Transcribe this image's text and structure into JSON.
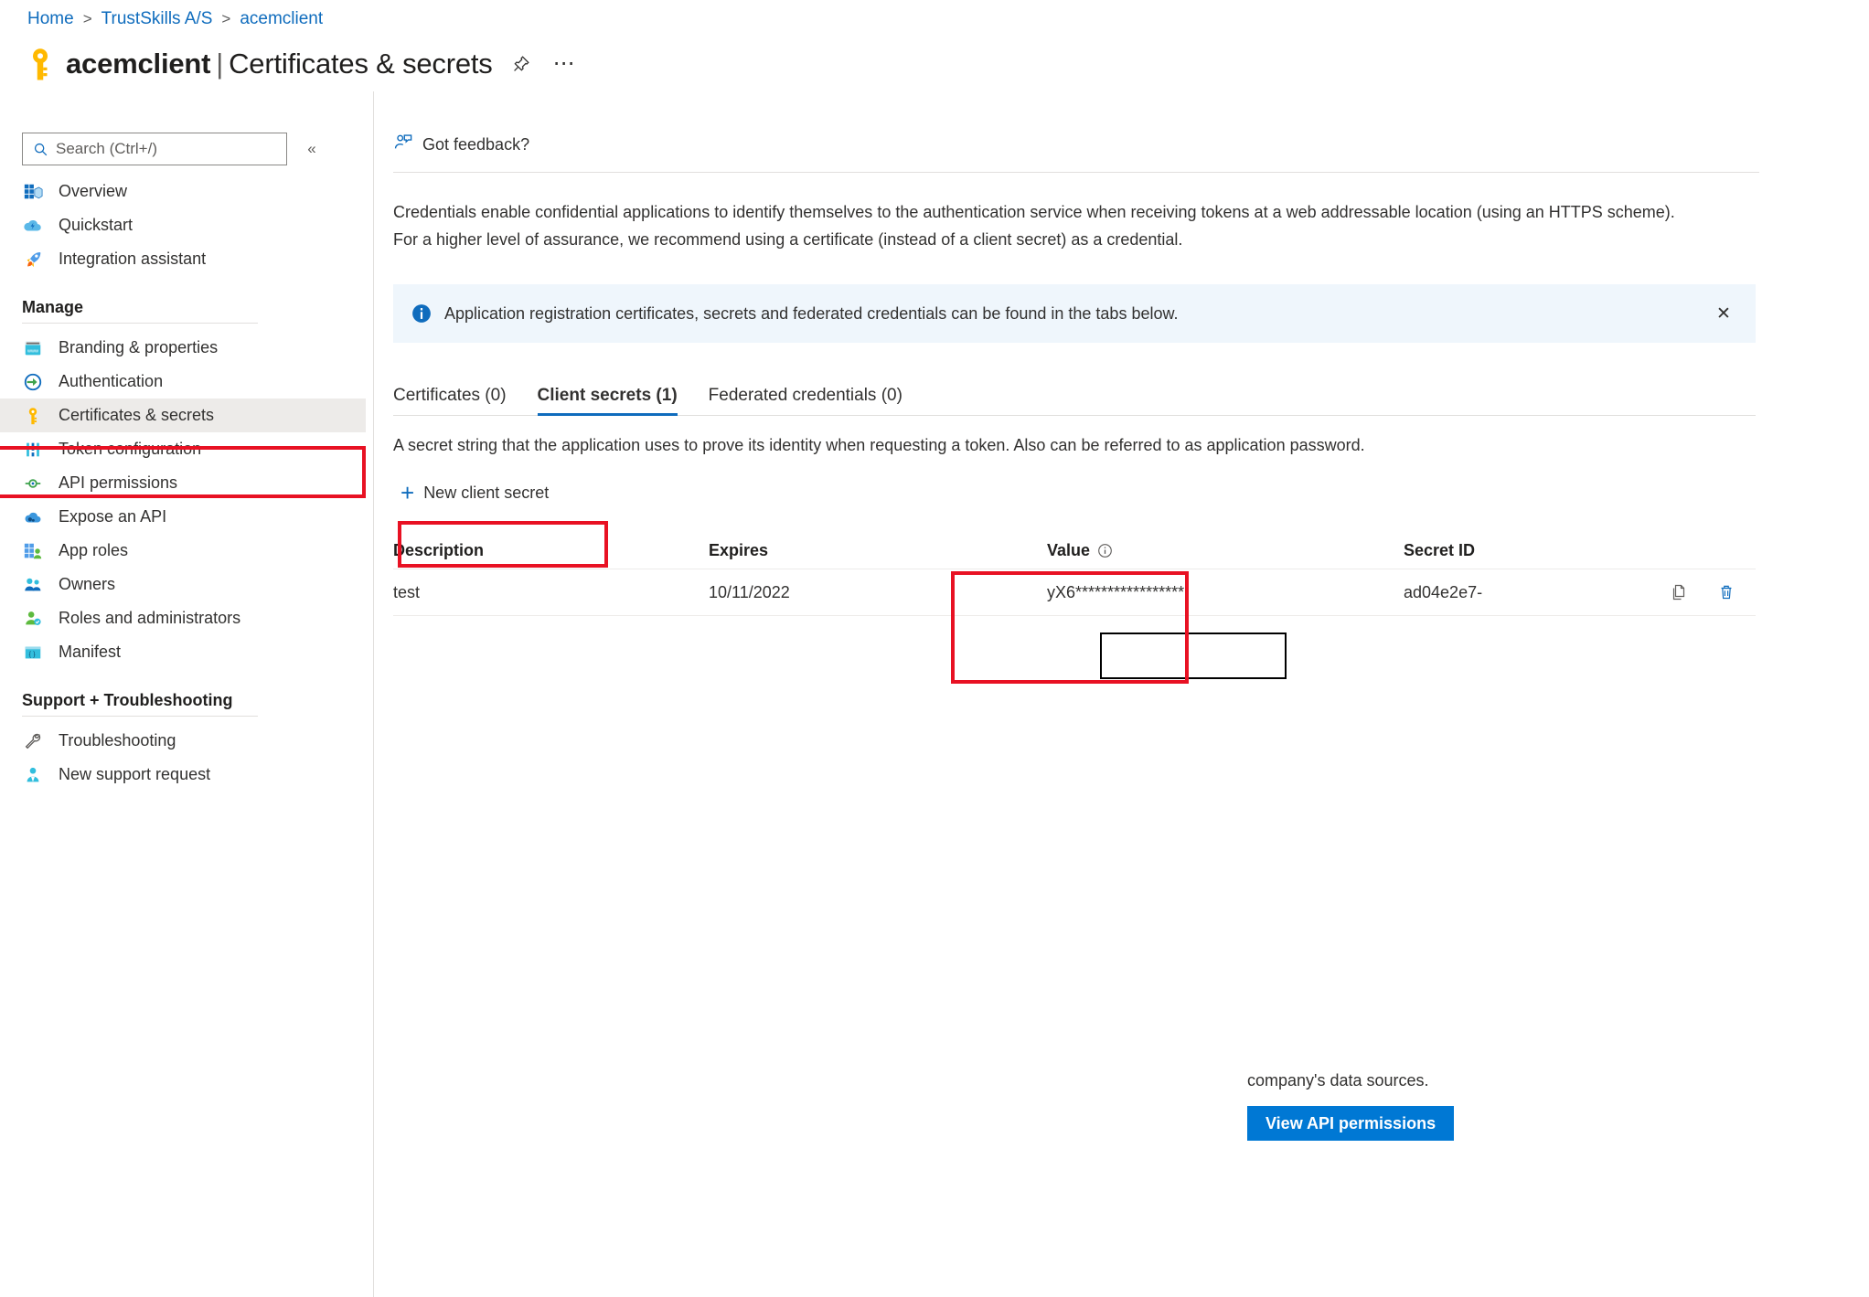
{
  "breadcrumb": {
    "items": [
      "Home",
      "TrustSkills A/S",
      "acemclient"
    ],
    "separator": ">"
  },
  "header": {
    "app_name": "acemclient",
    "separator": "|",
    "blade_name": "Certificates & secrets",
    "pin_title": "Pin blade",
    "more_title": "More",
    "icon": "key-icon"
  },
  "sidebar": {
    "search": {
      "placeholder": "Search (Ctrl+/)",
      "value": "",
      "icon": "search-icon"
    },
    "collapse_label": "«",
    "top_items": [
      {
        "label": "Overview",
        "icon": "overview-icon"
      },
      {
        "label": "Quickstart",
        "icon": "quickstart-cloud-icon"
      },
      {
        "label": "Integration assistant",
        "icon": "rocket-icon"
      }
    ],
    "manage_group": "Manage",
    "manage_items": [
      {
        "label": "Branding & properties",
        "icon": "branding-icon"
      },
      {
        "label": "Authentication",
        "icon": "authentication-icon"
      },
      {
        "label": "Certificates & secrets",
        "icon": "key-icon",
        "selected": true
      },
      {
        "label": "Token configuration",
        "icon": "token-icon"
      },
      {
        "label": "API permissions",
        "icon": "api-permissions-icon"
      },
      {
        "label": "Expose an API",
        "icon": "expose-api-icon"
      },
      {
        "label": "App roles",
        "icon": "app-roles-icon"
      },
      {
        "label": "Owners",
        "icon": "owners-icon"
      },
      {
        "label": "Roles and administrators",
        "icon": "roles-admin-icon"
      },
      {
        "label": "Manifest",
        "icon": "manifest-icon"
      }
    ],
    "support_group": "Support + Troubleshooting",
    "support_items": [
      {
        "label": "Troubleshooting",
        "icon": "wrench-icon"
      },
      {
        "label": "New support request",
        "icon": "support-person-icon"
      }
    ]
  },
  "main": {
    "feedback_label": "Got feedback?",
    "description": "Credentials enable confidential applications to identify themselves to the authentication service when receiving tokens at a web addressable location (using an HTTPS scheme). For a higher level of assurance, we recommend using a certificate (instead of a client secret) as a credential.",
    "info_banner": {
      "text": "Application registration certificates, secrets and federated credentials can be found in the tabs below.",
      "close_label": "✕",
      "icon": "info-icon",
      "background": "#eff6fc"
    },
    "tabs": [
      {
        "label": "Certificates (0)",
        "active": false
      },
      {
        "label": "Client secrets (1)",
        "active": true
      },
      {
        "label": "Federated credentials (0)",
        "active": false
      }
    ],
    "tab_description": "A secret string that the application uses to prove its identity when requesting a token. Also can be referred to as application password.",
    "new_secret_button": {
      "label": "New client secret",
      "icon": "plus-icon"
    },
    "table": {
      "columns": [
        "Description",
        "Expires",
        "Value",
        "Secret ID",
        ""
      ],
      "value_info_icon": "info-circle-icon",
      "rows": [
        {
          "description": "test",
          "expires": "10/11/2022",
          "value": "yX6*****************",
          "secret_id": "ad04e2e7-",
          "copy_icon": "copy-icon",
          "delete_icon": "trash-icon"
        }
      ]
    }
  },
  "bottom_card": {
    "text": "company's data sources.",
    "button_label": "View API permissions",
    "button_color": "#0078d4"
  },
  "annotations": {
    "accent_red": "#e81123",
    "boxes": [
      "certificates-and-secrets-nav",
      "new-client-secret-button",
      "value-column"
    ]
  }
}
